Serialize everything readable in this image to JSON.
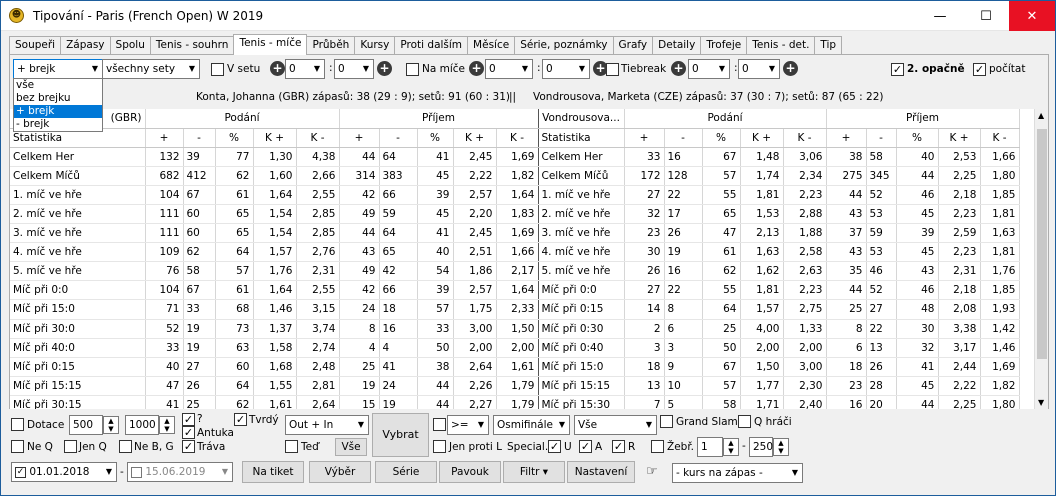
{
  "window": {
    "title": "Tipování - Paris (French Open) W 2019",
    "minimize": "—",
    "maximize": "☐",
    "close": "✕"
  },
  "tabs": [
    "Soupeři",
    "Zápasy",
    "Spolu",
    "Tenis - souhrn",
    "Tenis - míče",
    "Průběh",
    "Kursy",
    "Proti dalším",
    "Měsíce",
    "Série, poznámky",
    "Grafy",
    "Detaily",
    "Trofeje",
    "Tenis - det.",
    "Tip"
  ],
  "filters": {
    "break_select": "+ brejk",
    "sets_select": "všechny sety",
    "v_setu": "V setu",
    "na_mice": "Na míče",
    "tiebreak": "Tiebreak",
    "opacne": "2. opačně",
    "pocitat": "počítat",
    "zero": "0",
    "colon": ":"
  },
  "dropdown_options": [
    "vše",
    "bez brejku",
    "+ brejk",
    "- brejk"
  ],
  "info": {
    "p1": "Konta, Johanna (GBR)  zápasů: 38 (29 : 9);  setů: 91 (60 : 31)",
    "divider": "||",
    "p2": "Vondrousova, Marketa (CZE)  zápasů: 37 (30 : 7);  setů: 87 (65 : 22)"
  },
  "table": {
    "group_headers": {
      "p1_name": "(GBR)",
      "p2_name": "Vondrousova...",
      "podani": "Podání",
      "prijem": "Příjem"
    },
    "sub_headers": [
      "+",
      "-",
      "%",
      "K +",
      "K -",
      "+",
      "-",
      "%",
      "K +",
      "K -"
    ],
    "stat_label": "Statistika",
    "rows": [
      {
        "l1": "Celkem Her",
        "a": [
          "132",
          "39",
          "77",
          "1,30",
          "4,38",
          "44",
          "64",
          "41",
          "2,45",
          "1,69"
        ],
        "l2": "Celkem Her",
        "b": [
          "33",
          "16",
          "67",
          "1,48",
          "3,06",
          "38",
          "58",
          "40",
          "2,53",
          "1,66"
        ]
      },
      {
        "l1": "Celkem Míčů",
        "a": [
          "682",
          "412",
          "62",
          "1,60",
          "2,66",
          "314",
          "383",
          "45",
          "2,22",
          "1,82"
        ],
        "l2": "Celkem Míčů",
        "b": [
          "172",
          "128",
          "57",
          "1,74",
          "2,34",
          "275",
          "345",
          "44",
          "2,25",
          "1,80"
        ]
      },
      {
        "l1": "1. míč ve hře",
        "a": [
          "104",
          "67",
          "61",
          "1,64",
          "2,55",
          "42",
          "66",
          "39",
          "2,57",
          "1,64"
        ],
        "l2": "1. míč ve hře",
        "b": [
          "27",
          "22",
          "55",
          "1,81",
          "2,23",
          "44",
          "52",
          "46",
          "2,18",
          "1,85"
        ]
      },
      {
        "l1": "2. míč ve hře",
        "a": [
          "111",
          "60",
          "65",
          "1,54",
          "2,85",
          "49",
          "59",
          "45",
          "2,20",
          "1,83"
        ],
        "l2": "2. míč ve hře",
        "b": [
          "32",
          "17",
          "65",
          "1,53",
          "2,88",
          "43",
          "53",
          "45",
          "2,23",
          "1,81"
        ]
      },
      {
        "l1": "3. míč ve hře",
        "a": [
          "111",
          "60",
          "65",
          "1,54",
          "2,85",
          "44",
          "64",
          "41",
          "2,45",
          "1,69"
        ],
        "l2": "3. míč ve hře",
        "b": [
          "23",
          "26",
          "47",
          "2,13",
          "1,88",
          "37",
          "59",
          "39",
          "2,59",
          "1,63"
        ]
      },
      {
        "l1": "4. míč ve hře",
        "a": [
          "109",
          "62",
          "64",
          "1,57",
          "2,76",
          "43",
          "65",
          "40",
          "2,51",
          "1,66"
        ],
        "l2": "4. míč ve hře",
        "b": [
          "30",
          "19",
          "61",
          "1,63",
          "2,58",
          "43",
          "53",
          "45",
          "2,23",
          "1,81"
        ]
      },
      {
        "l1": "5. míč ve hře",
        "a": [
          "76",
          "58",
          "57",
          "1,76",
          "2,31",
          "49",
          "42",
          "54",
          "1,86",
          "2,17"
        ],
        "l2": "5. míč ve hře",
        "b": [
          "26",
          "16",
          "62",
          "1,62",
          "2,63",
          "35",
          "46",
          "43",
          "2,31",
          "1,76"
        ]
      },
      {
        "l1": "Míč při 0:0",
        "a": [
          "104",
          "67",
          "61",
          "1,64",
          "2,55",
          "42",
          "66",
          "39",
          "2,57",
          "1,64"
        ],
        "l2": "Míč při 0:0",
        "b": [
          "27",
          "22",
          "55",
          "1,81",
          "2,23",
          "44",
          "52",
          "46",
          "2,18",
          "1,85"
        ]
      },
      {
        "l1": "Míč při 15:0",
        "a": [
          "71",
          "33",
          "68",
          "1,46",
          "3,15",
          "24",
          "18",
          "57",
          "1,75",
          "2,33"
        ],
        "l2": "Míč při 0:15",
        "b": [
          "14",
          "8",
          "64",
          "1,57",
          "2,75",
          "25",
          "27",
          "48",
          "2,08",
          "1,93"
        ]
      },
      {
        "l1": "Míč při 30:0",
        "a": [
          "52",
          "19",
          "73",
          "1,37",
          "3,74",
          "8",
          "16",
          "33",
          "3,00",
          "1,50"
        ],
        "l2": "Míč při 0:30",
        "b": [
          "2",
          "6",
          "25",
          "4,00",
          "1,33",
          "8",
          "22",
          "30",
          "3,38",
          "1,42"
        ]
      },
      {
        "l1": "Míč při 40:0",
        "a": [
          "33",
          "19",
          "63",
          "1,58",
          "2,74",
          "4",
          "4",
          "50",
          "2,00",
          "2,00"
        ],
        "l2": "Míč při 0:40",
        "b": [
          "3",
          "3",
          "50",
          "2,00",
          "2,00",
          "6",
          "13",
          "32",
          "3,17",
          "1,46"
        ]
      },
      {
        "l1": "Míč při 0:15",
        "a": [
          "40",
          "27",
          "60",
          "1,68",
          "2,48",
          "25",
          "41",
          "38",
          "2,64",
          "1,61"
        ],
        "l2": "Míč při 15:0",
        "b": [
          "18",
          "9",
          "67",
          "1,50",
          "3,00",
          "18",
          "26",
          "41",
          "2,44",
          "1,69"
        ]
      },
      {
        "l1": "Míč při 15:15",
        "a": [
          "47",
          "26",
          "64",
          "1,55",
          "2,81",
          "19",
          "24",
          "44",
          "2,26",
          "1,79"
        ],
        "l2": "Míč při 15:15",
        "b": [
          "13",
          "10",
          "57",
          "1,77",
          "2,30",
          "23",
          "28",
          "45",
          "2,22",
          "1,82"
        ]
      },
      {
        "l1": "Míč při 30:15",
        "a": [
          "41",
          "25",
          "62",
          "1,61",
          "2,64",
          "15",
          "19",
          "44",
          "2,27",
          "1,79"
        ],
        "l2": "Míč při 15:30",
        "b": [
          "7",
          "5",
          "58",
          "1,71",
          "2,40",
          "16",
          "20",
          "44",
          "2,25",
          "1,80"
        ]
      }
    ]
  },
  "bottom": {
    "dotace": "Dotace",
    "d_from": "500",
    "d_to": "1000",
    "q_mark": "?",
    "antuka": "Antuka",
    "trava": "Tráva",
    "tvrdy": "Tvrdý",
    "out_in": "Out + In",
    "ted": "Teď",
    "vse_btn": "Vše",
    "vybrat": "Vybrat",
    "op": ">=",
    "round": "Osmifinále",
    "vse_sel": "Vše",
    "grand_slam": "Grand Slam",
    "q_hraci": "Q hráči",
    "ne_q": "Ne Q",
    "jen_q": "Jen Q",
    "ne_bg": "Ne B, G",
    "jen_proti_l": "Jen proti L",
    "special": "Special.",
    "u": "U",
    "a": "A",
    "r": "R",
    "zebr": "Žebř.",
    "z_from": "1",
    "z_to": "250",
    "date_from": "01.01.2018",
    "dash": "-",
    "date_to": "15.06.2019",
    "na_tiket": "Na tiket",
    "vyber": "Výběr",
    "serie": "Série",
    "pavouk": "Pavouk",
    "filtr": "Filtr ▾",
    "nastaveni": "Nastavení",
    "kurs": "- kurs na zápas -"
  }
}
